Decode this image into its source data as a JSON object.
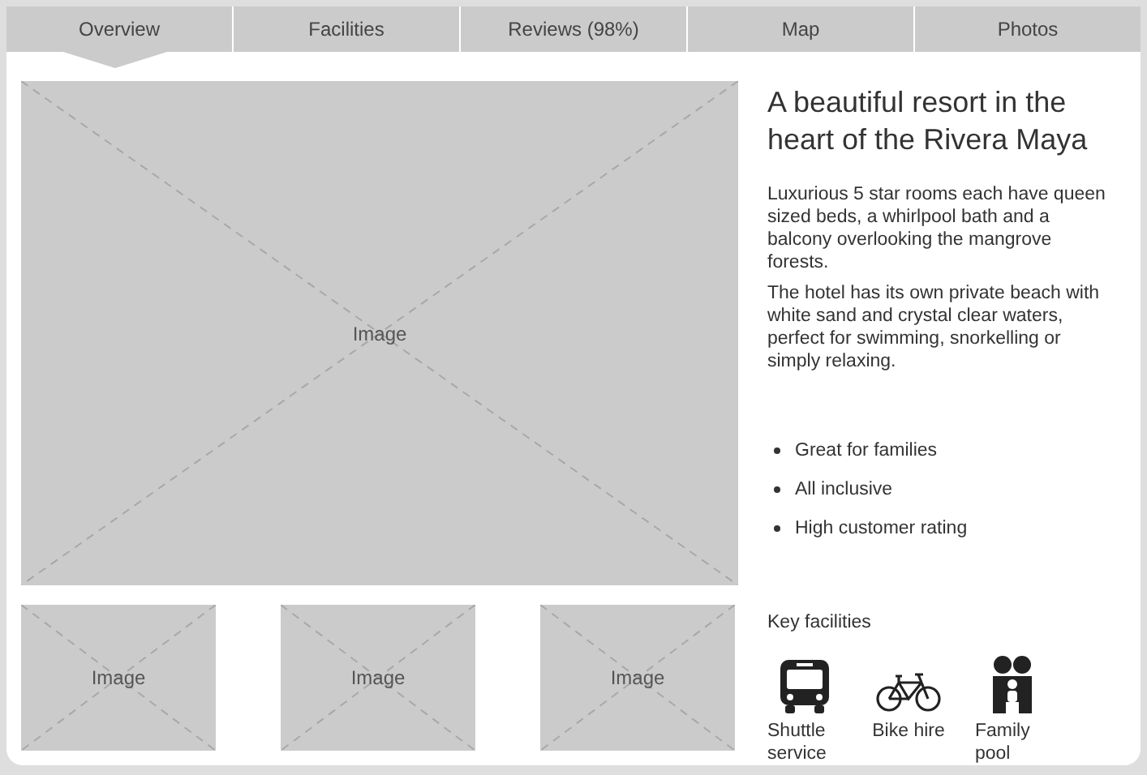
{
  "tabs": [
    {
      "label": "Overview",
      "selected": true
    },
    {
      "label": "Facilities",
      "selected": false
    },
    {
      "label": "Reviews (98%)",
      "selected": false
    },
    {
      "label": "Map",
      "selected": false
    },
    {
      "label": "Photos",
      "selected": false
    }
  ],
  "main_image": {
    "label": "Image"
  },
  "thumbnails": [
    {
      "label": "Image"
    },
    {
      "label": "Image"
    },
    {
      "label": "Image"
    }
  ],
  "title": "A beautiful resort in the heart of the Rivera Maya",
  "paragraphs": [
    "Luxurious 5 star rooms each have queen sized beds, a whirlpool bath and a balcony overlooking the mangrove forests.",
    "The hotel has its own private beach with white sand and crystal clear waters, perfect for swimming, snorkelling or simply relaxing."
  ],
  "highlights": [
    "Great for families",
    "All inclusive",
    "High customer rating"
  ],
  "key_facilities": {
    "heading": "Key facilities",
    "items": [
      {
        "kind": "bus",
        "label": "Shuttle service"
      },
      {
        "kind": "bike",
        "label": "Bike hire"
      },
      {
        "kind": "family",
        "label": "Family pool"
      }
    ]
  }
}
